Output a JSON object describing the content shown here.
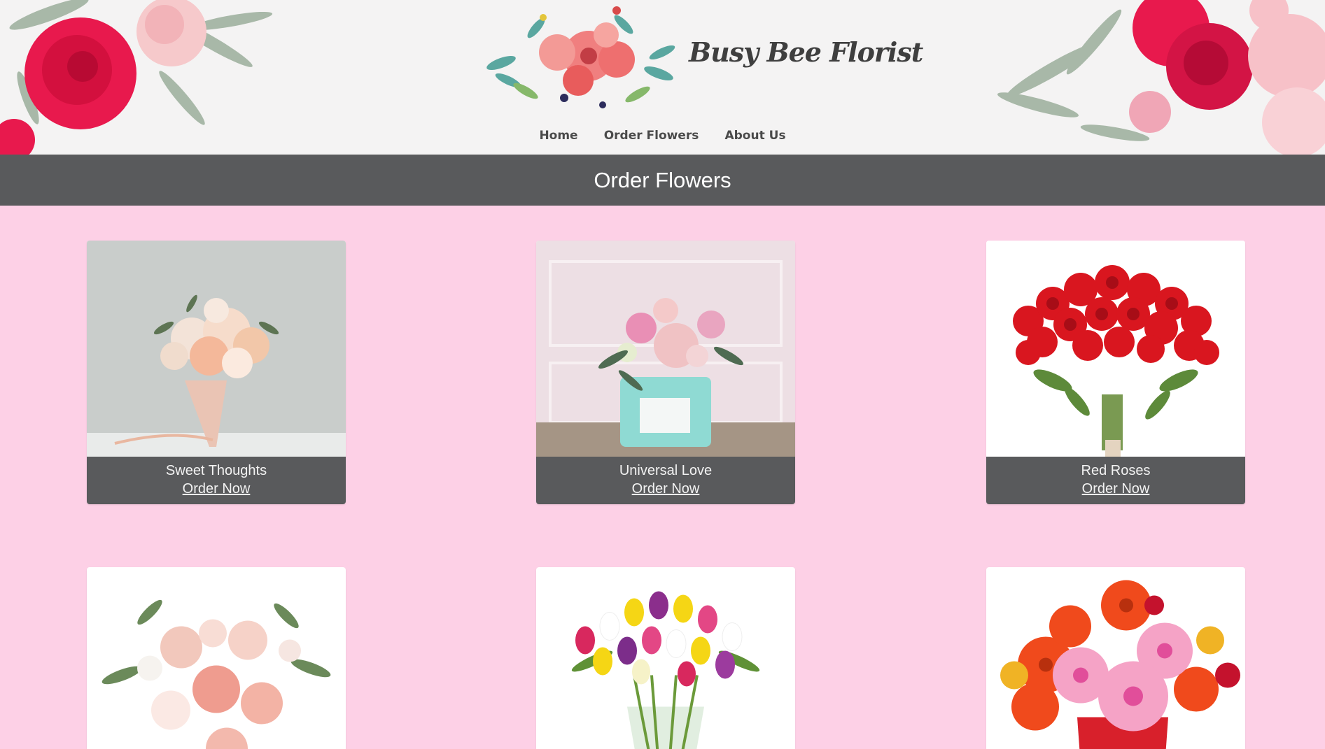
{
  "header": {
    "brand": "Busy Bee Florist",
    "nav": [
      "Home",
      "Order Flowers",
      "About Us"
    ]
  },
  "page_title": "Order Flowers",
  "products": [
    {
      "name": "Sweet Thoughts",
      "cta": "Order Now"
    },
    {
      "name": "Universal Love",
      "cta": "Order Now"
    },
    {
      "name": "Red Roses",
      "cta": "Order Now"
    }
  ],
  "colors": {
    "page_background": "#fdd0e6",
    "header_background": "#f4f3f3",
    "title_bar": "#595a5c",
    "caption_bar": "#595a5c"
  }
}
